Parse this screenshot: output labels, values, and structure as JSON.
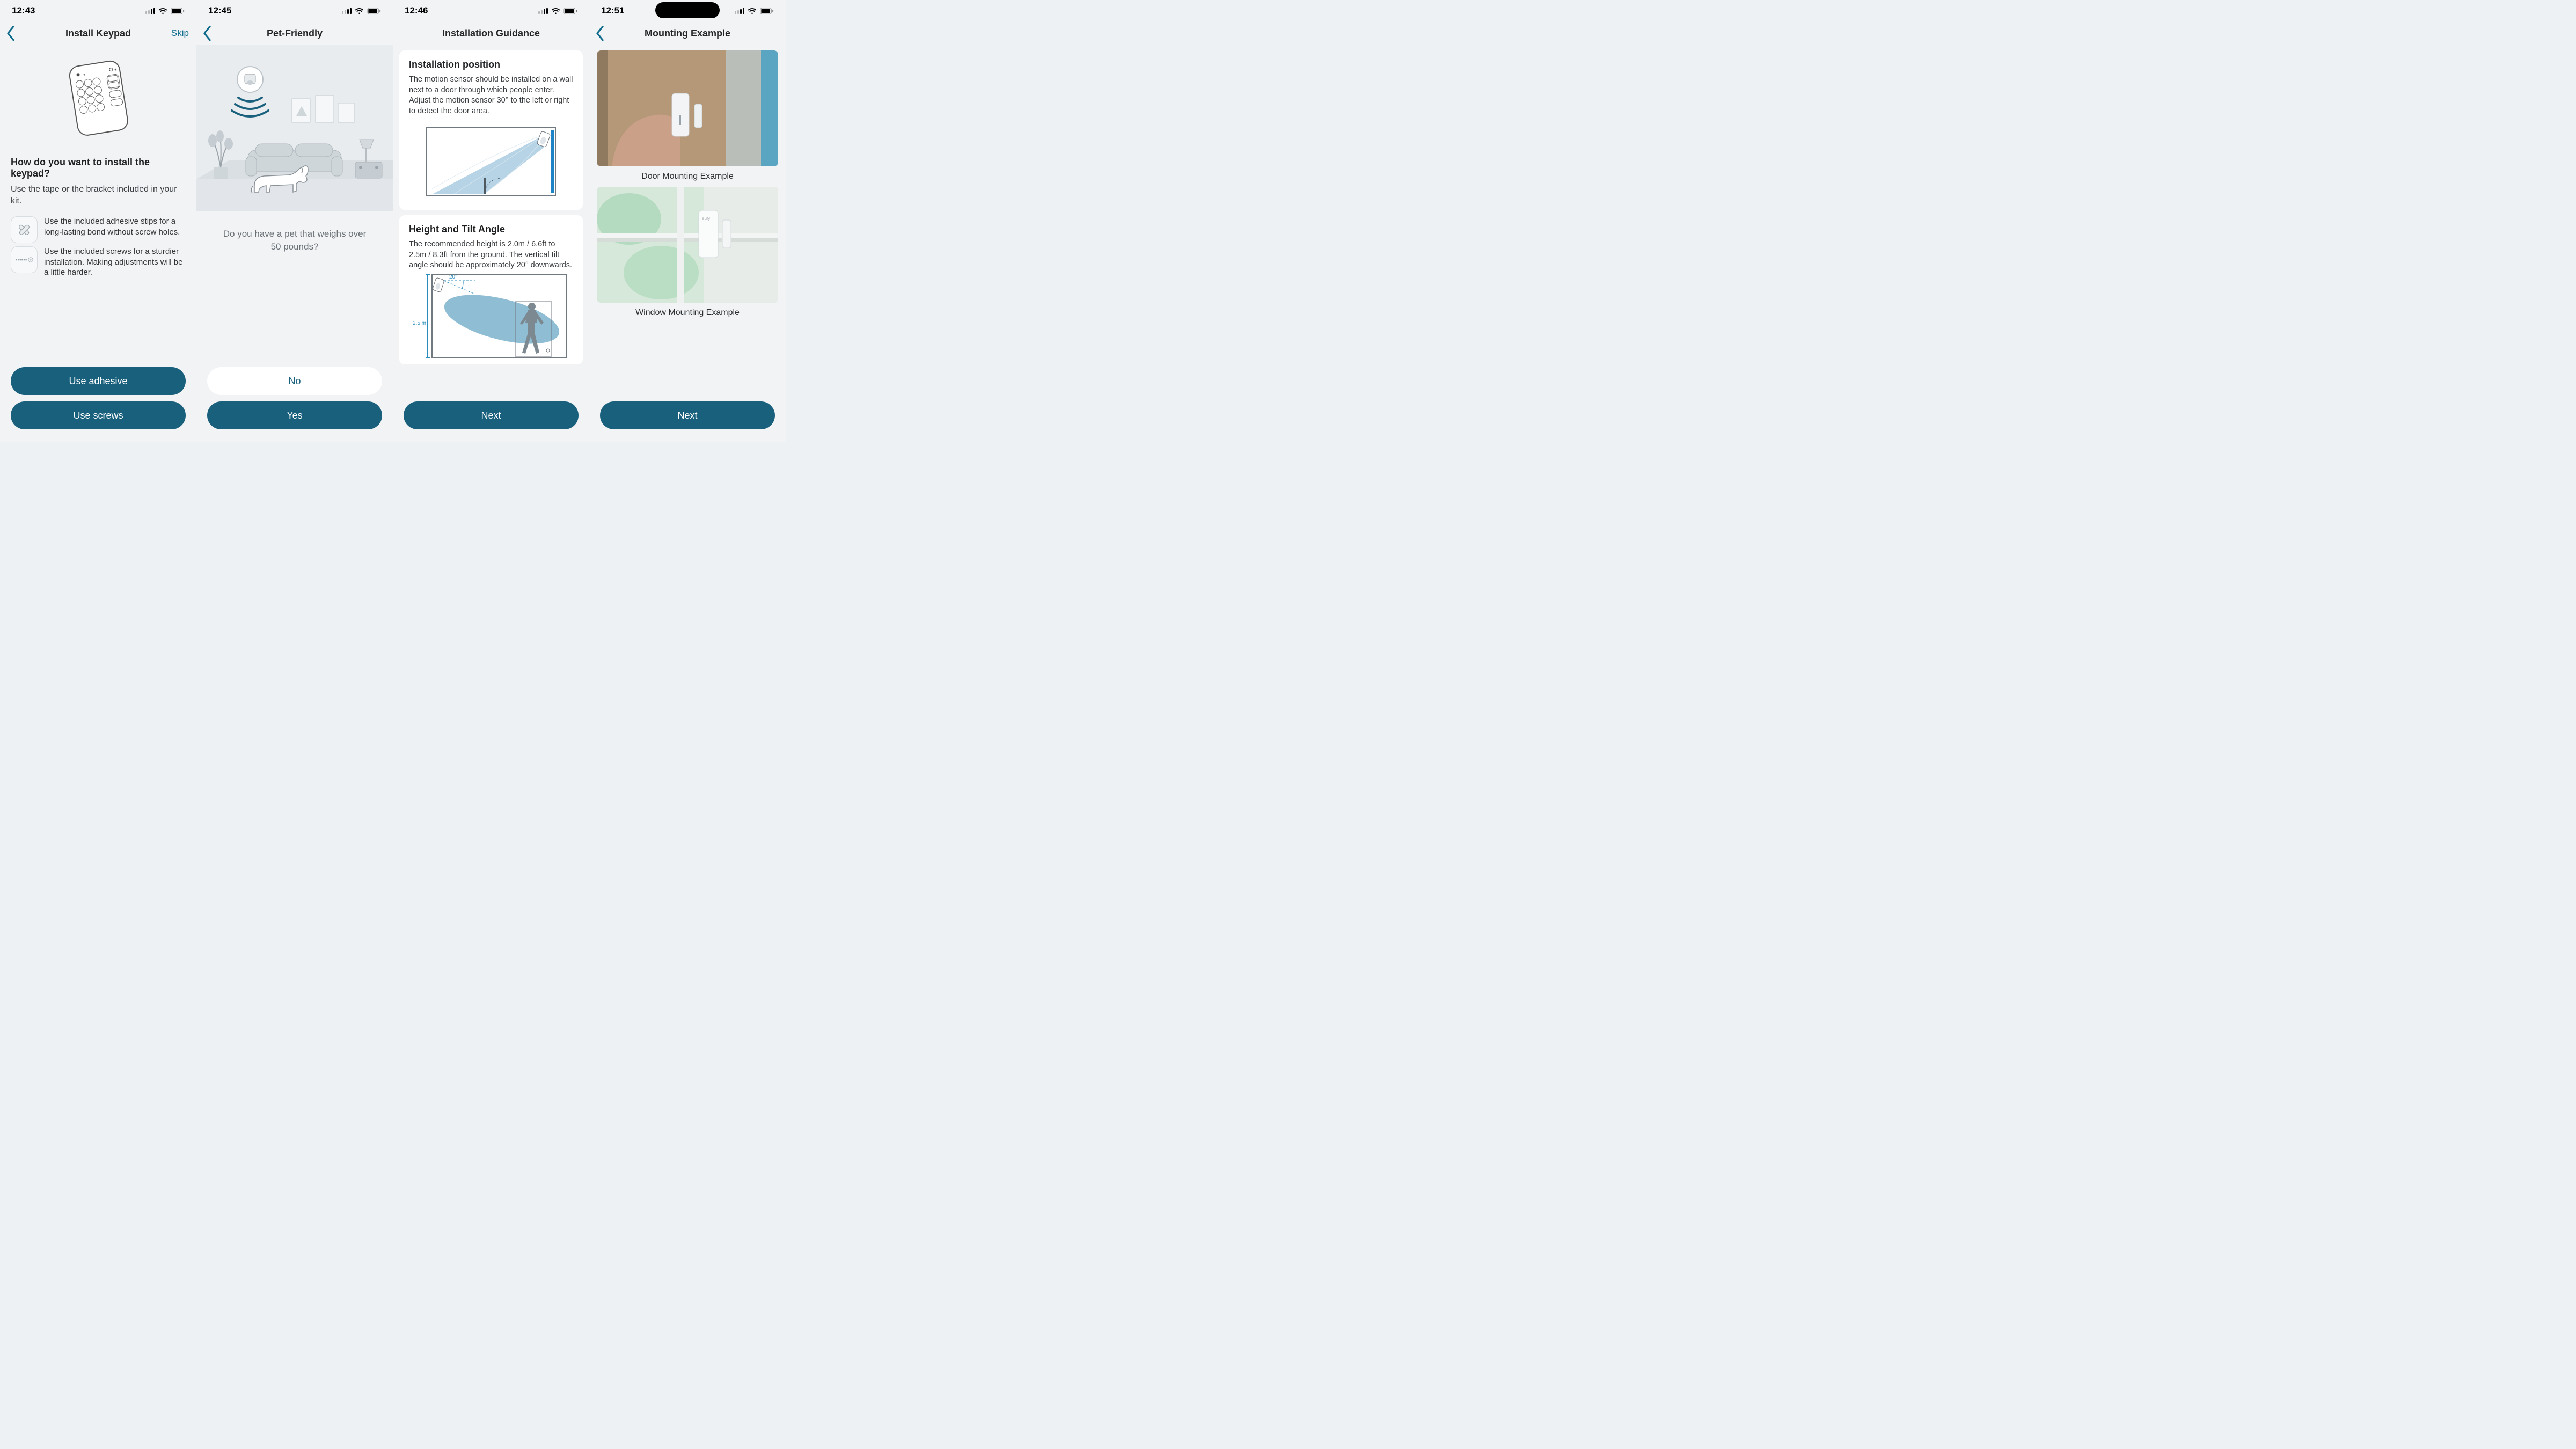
{
  "accent": "#19607d",
  "screens": [
    {
      "time": "12:43",
      "title": "Install Keypad",
      "skip": "Skip",
      "question": "How do you want to install the keypad?",
      "subtext": "Use the tape or the bracket included in your kit.",
      "options": [
        {
          "icon": "tape-icon",
          "text": "Use the included adhesive stips for a long-lasting bond without screw holes."
        },
        {
          "icon": "screw-icon",
          "text": "Use the included screws for a sturdier installation. Making adjustments will be a little harder."
        }
      ],
      "buttons": [
        {
          "label": "Use adhesive",
          "style": "primary"
        },
        {
          "label": "Use screws",
          "style": "primary"
        }
      ]
    },
    {
      "time": "12:45",
      "title": "Pet-Friendly",
      "question": "Do you have a pet that weighs over 50 pounds?",
      "buttons": [
        {
          "label": "No",
          "style": "secondary"
        },
        {
          "label": "Yes",
          "style": "primary"
        }
      ]
    },
    {
      "time": "12:46",
      "title": "Installation Guidance",
      "cards": [
        {
          "heading": "Installation position",
          "body": "The motion sensor should be installed on a wall next to a door through which people enter. Adjust the motion sensor 30° to the left or right to detect the door area."
        },
        {
          "heading": "Height and Tilt Angle",
          "body": "The recommended height is 2.0m / 6.6ft to 2.5m / 8.3ft from the ground. The vertical tilt angle should be approximately 20° downwards.",
          "labels": {
            "angle": "20°",
            "height": "2.5 m"
          }
        }
      ],
      "buttons": [
        {
          "label": "Next",
          "style": "primary"
        }
      ]
    },
    {
      "time": "12:51",
      "title": "Mounting Example",
      "has_pill": true,
      "examples": [
        {
          "caption": "Door Mounting Example"
        },
        {
          "caption": "Window Mounting Example"
        }
      ],
      "buttons": [
        {
          "label": "Next",
          "style": "primary"
        }
      ]
    }
  ]
}
